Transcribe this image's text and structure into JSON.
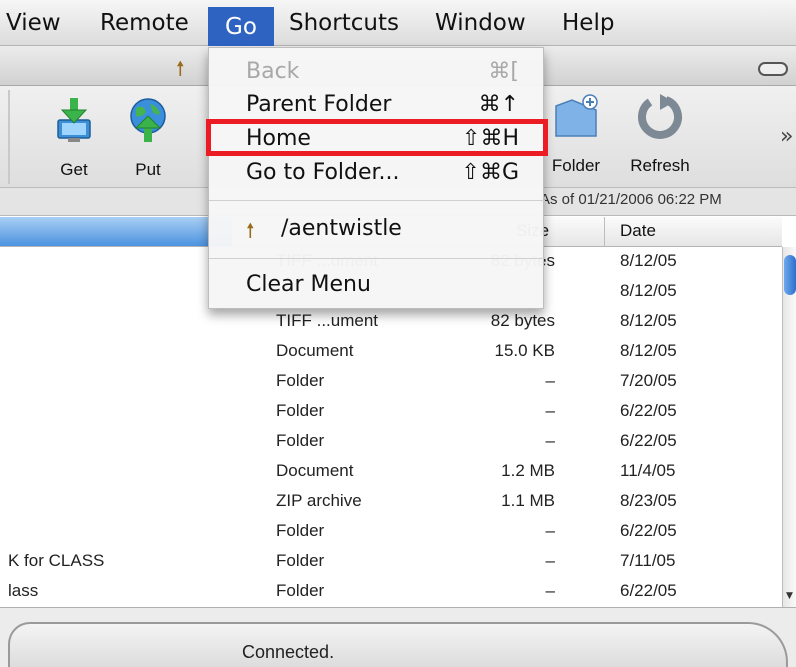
{
  "menubar": {
    "items": [
      "View",
      "Remote",
      "Go",
      "Shortcuts",
      "Window",
      "Help"
    ]
  },
  "toolbar": {
    "get_label": "Get",
    "put_label": "Put",
    "folder_label": "Folder",
    "refresh_label": "Refresh"
  },
  "info": {
    "as_of": "As of 01/21/2006 06:22 PM"
  },
  "columns": {
    "size": "Size",
    "date": "Date"
  },
  "rows": [
    {
      "name": "",
      "kind": "TIFF ...ument",
      "size": "82 bytes",
      "date": "8/12/05"
    },
    {
      "name": "",
      "kind": "",
      "size": "",
      "date": "8/12/05"
    },
    {
      "name": "",
      "kind": "TIFF ...ument",
      "size": "82 bytes",
      "date": "8/12/05"
    },
    {
      "name": "",
      "kind": "Document",
      "size": "15.0 KB",
      "date": "8/12/05"
    },
    {
      "name": "",
      "kind": "Folder",
      "size": "–",
      "date": "7/20/05"
    },
    {
      "name": "",
      "kind": "Folder",
      "size": "–",
      "date": "6/22/05"
    },
    {
      "name": "",
      "kind": "Folder",
      "size": "–",
      "date": "6/22/05"
    },
    {
      "name": "",
      "kind": "Document",
      "size": "1.2 MB",
      "date": "11/4/05"
    },
    {
      "name": "",
      "kind": "ZIP archive",
      "size": "1.1 MB",
      "date": "8/23/05"
    },
    {
      "name": "",
      "kind": "Folder",
      "size": "–",
      "date": "6/22/05"
    },
    {
      "name": "K for CLASS",
      "kind": "Folder",
      "size": "–",
      "date": "7/11/05"
    },
    {
      "name": "lass",
      "kind": "Folder",
      "size": "–",
      "date": "6/22/05"
    }
  ],
  "go_menu": {
    "back": {
      "label": "Back",
      "shortcut": "⌘["
    },
    "parent": {
      "label": "Parent Folder",
      "shortcut": "⌘↑"
    },
    "home": {
      "label": "Home",
      "shortcut": "⇧⌘H"
    },
    "goto": {
      "label": "Go to Folder...",
      "shortcut": "⇧⌘G"
    },
    "recent": {
      "label": "/aentwistle"
    },
    "clear": {
      "label": "Clear Menu"
    }
  },
  "status": {
    "text": "Connected."
  },
  "colors": {
    "menu_highlight": "#2f63c2",
    "annotation_box": "#ec1c24",
    "sort_column": "#4c93e0"
  }
}
